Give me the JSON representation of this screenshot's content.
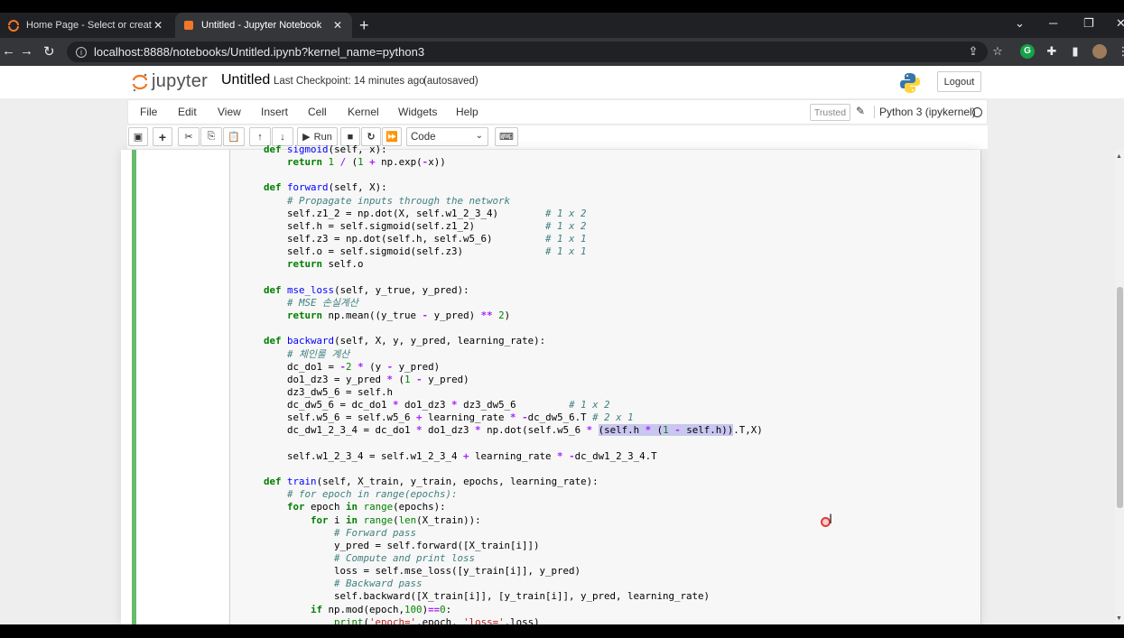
{
  "browser": {
    "tabs": [
      {
        "title": "Home Page - Select or create a n",
        "active": false
      },
      {
        "title": "Untitled - Jupyter Notebook",
        "active": true
      }
    ],
    "url": "localhost:8888/notebooks/Untitled.ipynb?kernel_name=python3"
  },
  "header": {
    "logo_text": "jupyter",
    "notebook_title": "Untitled",
    "checkpoint": "Last Checkpoint: 14 minutes ago",
    "autosave_status": "(autosaved)",
    "logout_label": "Logout"
  },
  "menu": {
    "items": [
      "File",
      "Edit",
      "View",
      "Insert",
      "Cell",
      "Kernel",
      "Widgets",
      "Help"
    ],
    "trusted_label": "Trusted",
    "kernel_name": "Python 3 (ipykernel)"
  },
  "toolbar": {
    "run_label": "Run",
    "cell_type": "Code"
  },
  "code_lines": [
    "    def sigmoid(self, x):",
    "        return 1 / (1 + np.exp(-x))",
    "",
    "    def forward(self, X):",
    "        # Propagate inputs through the network",
    "        self.z1_2 = np.dot(X, self.w1_2_3_4)        # 1 x 2",
    "        self.h = self.sigmoid(self.z1_2)            # 1 x 2",
    "        self.z3 = np.dot(self.h, self.w5_6)         # 1 x 1",
    "        self.o = self.sigmoid(self.z3)              # 1 x 1",
    "        return self.o",
    "",
    "    def mse_loss(self, y_true, y_pred):",
    "        # MSE 손실계산",
    "        return np.mean((y_true - y_pred) ** 2)",
    "",
    "    def backward(self, X, y, y_pred, learning_rate):",
    "        # 체인룰 계산",
    "        dc_do1 = -2 * (y - y_pred)",
    "        do1_dz3 = y_pred * (1 - y_pred)",
    "        dz3_dw5_6 = self.h",
    "        dc_dw5_6 = dc_do1 * do1_dz3 * dz3_dw5_6         # 1 x 2",
    "        self.w5_6 = self.w5_6 + learning_rate * -dc_dw5_6.T # 2 x 1",
    "        dc_dw1_2_3_4 = dc_do1 * do1_dz3 * np.dot(self.w5_6 * (self.h * (1 - self.h)).T,X)",
    "",
    "        self.w1_2_3_4 = self.w1_2_3_4 + learning_rate * -dc_dw1_2_3_4.T",
    "",
    "    def train(self, X_train, y_train, epochs, learning_rate):",
    "        # for epoch in range(epochs):",
    "        for epoch in range(epochs):",
    "            for i in range(len(X_train)):",
    "                # Forward pass",
    "                y_pred = self.forward([X_train[i]])",
    "                # Compute and print loss",
    "                loss = self.mse_loss([y_train[i]], y_pred)",
    "                # Backward pass",
    "                self.backward([X_train[i]], [y_train[i]], y_pred, learning_rate)",
    "            if np.mod(epoch,100)==0:",
    "                print('epoch=',epoch, 'loss=',loss)"
  ]
}
